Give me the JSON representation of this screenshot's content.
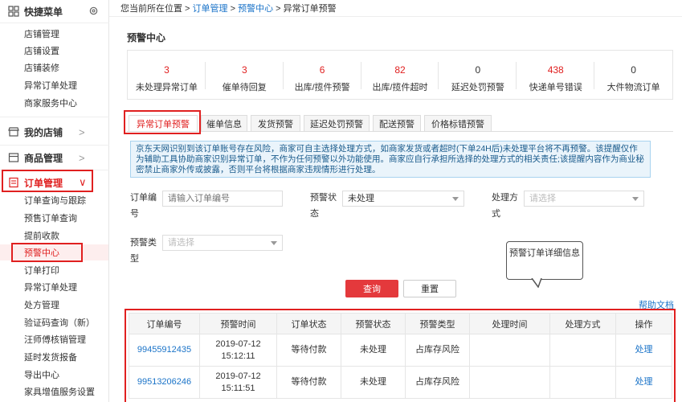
{
  "sidebar": {
    "quick_menu": {
      "title": "快捷菜单",
      "items": [
        "店铺管理",
        "店铺设置",
        "店铺装修",
        "异常订单处理",
        "商家服务中心"
      ]
    },
    "my_shop": {
      "title": "我的店铺"
    },
    "goods": {
      "title": "商品管理"
    },
    "orders": {
      "title": "订单管理",
      "items": [
        "订单查询与跟踪",
        "预售订单查询",
        "提前收款",
        "预警中心",
        "订单打印",
        "异常订单处理",
        "处方管理",
        "验证码查询（新）",
        "汪师傅核销管理",
        "延时发货报备",
        "导出中心",
        "家具增值服务设置"
      ]
    }
  },
  "breadcrumb": {
    "prefix": "您当前所在位置 >",
    "level1": "订单管理",
    "sep1": ">",
    "level2": "预警中心",
    "sep2": ">",
    "level3": "异常订单预警"
  },
  "page_title": "预警中心",
  "stats": [
    {
      "value": "3",
      "label": "未处理异常订单"
    },
    {
      "value": "3",
      "label": "催单待回复"
    },
    {
      "value": "6",
      "label": "出库/揽件预警"
    },
    {
      "value": "82",
      "label": "出库/揽件超时"
    },
    {
      "value": "0",
      "label": "延迟处罚预警"
    },
    {
      "value": "438",
      "label": "快递单号错误"
    },
    {
      "value": "0",
      "label": "大件物流订单"
    }
  ],
  "tabs": [
    "异常订单预警",
    "催单信息",
    "发货预警",
    "延迟处罚预警",
    "配送预警",
    "价格标错预警"
  ],
  "notice": "京东天网识别到该订单账号存在风险，商家可自主选择处理方式，如商家发货或者超时(下单24H后)未处理平台将不再预警。该提醒仅作为辅助工具协助商家识别异常订单，不作为任何预警以外功能使用。商家应自行承担所选择的处理方式的相关责任;该提醒内容作为商业秘密禁止商家外传或披露，否则平台将根据商家违规情形进行处理。",
  "filters": {
    "order_no": {
      "label": "订单编号",
      "placeholder": "请输入订单编号"
    },
    "warn_status": {
      "label": "预警状态",
      "value": "未处理"
    },
    "handle_method": {
      "label": "处理方式",
      "placeholder": "请选择"
    },
    "warn_type": {
      "label": "预警类型",
      "placeholder": "请选择"
    }
  },
  "buttons": {
    "query": "查询",
    "reset": "重置"
  },
  "callout": "预警订单详细信息",
  "help": "帮助文档",
  "table": {
    "headers": [
      "订单编号",
      "预警时间",
      "订单状态",
      "预警状态",
      "预警类型",
      "处理时间",
      "处理方式",
      "操作"
    ],
    "rows": [
      {
        "order_no": "99455912435",
        "warn_time": "2019-07-12 15:12:11",
        "order_status": "等待付款",
        "warn_status": "未处理",
        "warn_type": "占库存风险",
        "handle_time": "",
        "handle_method": "",
        "action": "处理"
      },
      {
        "order_no": "99513206246",
        "warn_time": "2019-07-12 15:11:51",
        "order_status": "等待付款",
        "warn_status": "未处理",
        "warn_type": "占库存风险",
        "handle_time": "",
        "handle_method": "",
        "action": "处理"
      }
    ]
  }
}
